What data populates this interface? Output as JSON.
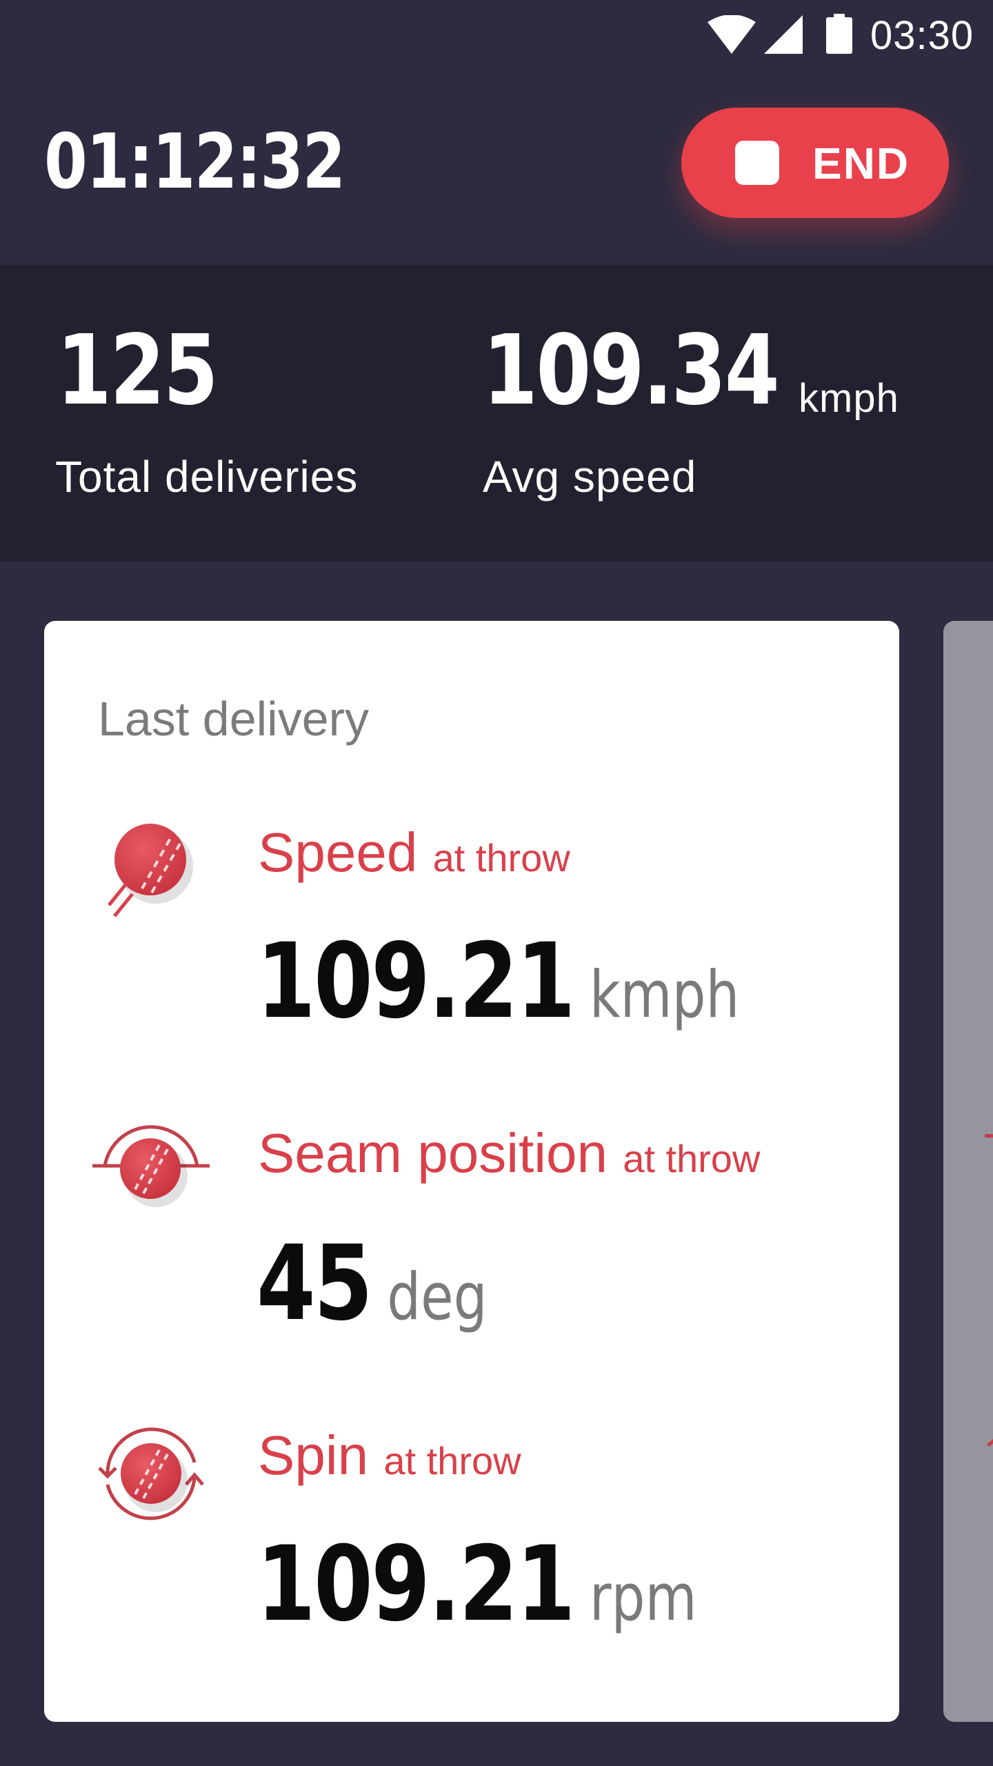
{
  "status_bar": {
    "time": "03:30"
  },
  "session": {
    "timer": "01:12:32",
    "end_label": "END"
  },
  "stats": {
    "total_deliveries": {
      "value": "125",
      "label": "Total deliveries"
    },
    "avg_speed": {
      "value": "109.34",
      "unit": "kmph",
      "label": "Avg speed"
    }
  },
  "last_delivery": {
    "title": "Last delivery",
    "metrics": [
      {
        "icon": "ball-speed-icon",
        "label": "Speed",
        "qualifier": "at throw",
        "value": "109.21",
        "unit": "kmph"
      },
      {
        "icon": "ball-seam-icon",
        "label": "Seam position",
        "qualifier": "at throw",
        "value": "45",
        "unit": "deg"
      },
      {
        "icon": "ball-spin-icon",
        "label": "Spin",
        "qualifier": "at throw",
        "value": "109.21",
        "unit": "rpm"
      }
    ]
  },
  "colors": {
    "background": "#2d2b3f",
    "stats_band": "#22212f",
    "accent": "#e8414b",
    "metric_label": "#d9404a"
  }
}
